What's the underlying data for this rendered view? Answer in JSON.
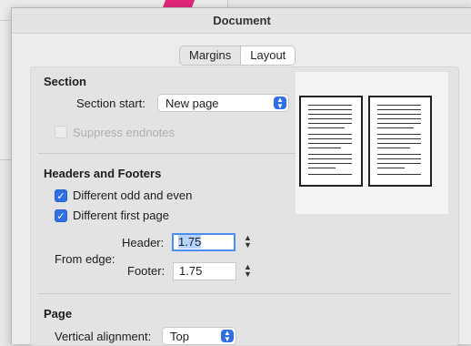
{
  "dialog": {
    "title": "Document",
    "tabs": [
      {
        "label": "Margins",
        "active": false
      },
      {
        "label": "Layout",
        "active": true
      }
    ]
  },
  "section": {
    "heading": "Section",
    "start_label": "Section start:",
    "start_value": "New page",
    "suppress_endnotes_label": "Suppress endnotes",
    "suppress_endnotes_checked": false,
    "suppress_endnotes_enabled": false
  },
  "headers_footers": {
    "heading": "Headers and Footers",
    "diff_odd_even_label": "Different odd and even",
    "diff_odd_even_checked": true,
    "diff_first_page_label": "Different first page",
    "diff_first_page_checked": true,
    "from_edge_label": "From edge:",
    "header_label": "Header:",
    "header_value": "1.75",
    "footer_label": "Footer:",
    "footer_value": "1.75"
  },
  "page": {
    "heading": "Page",
    "vertical_alignment_label": "Vertical alignment:",
    "vertical_alignment_value": "Top"
  },
  "icons": {
    "checkmark": "✓",
    "select_arrows": "▲▼",
    "stepper_arrows": "▲▼"
  },
  "colors": {
    "accent": "#2f6fe4",
    "background_shape": "#e3277a"
  }
}
